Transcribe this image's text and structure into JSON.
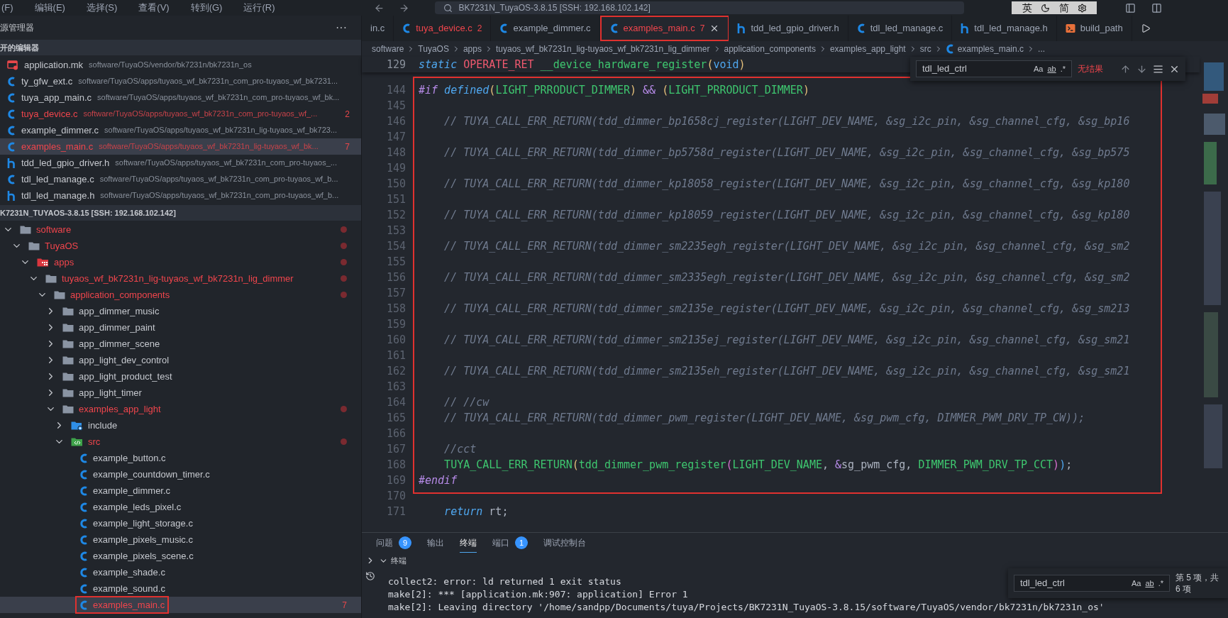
{
  "title_bar": {
    "menus": [
      "(F)",
      "编辑(E)",
      "选择(S)",
      "查看(V)",
      "转到(G)",
      "运行(R)"
    ],
    "command_center": "BK7231N_TuyaOS-3.8.15 [SSH: 192.168.102.142]",
    "ime": [
      "英",
      "简"
    ]
  },
  "explorer": {
    "title": "源管理器",
    "more": "···",
    "open_editors": {
      "title": "开的编辑器",
      "items": [
        {
          "name": "application.mk",
          "path": "software/TuyaOS/vendor/bk7231n/bk7231n_os",
          "kind": "mk-file",
          "error": false,
          "selected": false
        },
        {
          "name": "ty_gfw_ext.c",
          "path": "software/TuyaOS/apps/tuyaos_wf_bk7231n_com_pro-tuyaos_wf_bk7231...",
          "kind": "c-file",
          "error": false,
          "selected": false
        },
        {
          "name": "tuya_app_main.c",
          "path": "software/TuyaOS/apps/tuyaos_wf_bk7231n_com_pro-tuyaos_wf_bk...",
          "kind": "c-file",
          "error": false,
          "selected": false
        },
        {
          "name": "tuya_device.c",
          "path": "software/TuyaOS/apps/tuyaos_wf_bk7231n_com_pro-tuyaos_wf_...",
          "kind": "c-file",
          "badge": "2",
          "error": true,
          "selected": false
        },
        {
          "name": "example_dimmer.c",
          "path": "software/TuyaOS/apps/tuyaos_wf_bk7231n_lig-tuyaos_wf_bk723...",
          "kind": "c-file",
          "error": false,
          "selected": false
        },
        {
          "name": "examples_main.c",
          "path": "software/TuyaOS/apps/tuyaos_wf_bk7231n_lig-tuyaos_wf_bk...",
          "kind": "c-file",
          "badge": "7",
          "error": true,
          "selected": true
        },
        {
          "name": "tdd_led_gpio_driver.h",
          "path": "software/TuyaOS/apps/tuyaos_wf_bk7231n_com_pro-tuyaos_...",
          "kind": "h-file",
          "error": false,
          "selected": false
        },
        {
          "name": "tdl_led_manage.c",
          "path": "software/TuyaOS/apps/tuyaos_wf_bk7231n_com_pro-tuyaos_wf_b...",
          "kind": "c-file",
          "error": false,
          "selected": false
        },
        {
          "name": "tdl_led_manage.h",
          "path": "software/TuyaOS/apps/tuyaos_wf_bk7231n_com_pro-tuyaos_wf_b...",
          "kind": "h-file",
          "error": false,
          "selected": false
        }
      ]
    },
    "workspace": {
      "title": "K7231N_TUYAOS-3.8.15 [SSH: 192.168.102.142]",
      "tree": [
        {
          "label": "software",
          "kind": "folder",
          "expanded": true,
          "error": true,
          "selected": false,
          "framed": false,
          "children": [
            {
              "label": "TuyaOS",
              "kind": "folder",
              "expanded": true,
              "error": true,
              "selected": false,
              "framed": false,
              "children": [
                {
                  "label": "apps",
                  "kind": "app-folder",
                  "expanded": true,
                  "error": true,
                  "selected": false,
                  "framed": false,
                  "children": [
                    {
                      "label": "tuyaos_wf_bk7231n_lig-tuyaos_wf_bk7231n_lig_dimmer",
                      "kind": "folder",
                      "expanded": true,
                      "error": true,
                      "selected": false,
                      "framed": false,
                      "children": [
                        {
                          "label": "application_components",
                          "kind": "folder",
                          "expanded": true,
                          "error": true,
                          "selected": false,
                          "framed": false,
                          "children": [
                            {
                              "label": "app_dimmer_music",
                              "kind": "folder",
                              "expanded": false,
                              "error": false,
                              "selected": false,
                              "framed": false
                            },
                            {
                              "label": "app_dimmer_paint",
                              "kind": "folder",
                              "expanded": false,
                              "error": false,
                              "selected": false,
                              "framed": false
                            },
                            {
                              "label": "app_dimmer_scene",
                              "kind": "folder",
                              "expanded": false,
                              "error": false,
                              "selected": false,
                              "framed": false
                            },
                            {
                              "label": "app_light_dev_control",
                              "kind": "folder",
                              "expanded": false,
                              "error": false,
                              "selected": false,
                              "framed": false
                            },
                            {
                              "label": "app_light_product_test",
                              "kind": "folder",
                              "expanded": false,
                              "error": false,
                              "selected": false,
                              "framed": false
                            },
                            {
                              "label": "app_light_timer",
                              "kind": "folder",
                              "expanded": false,
                              "error": false,
                              "selected": false,
                              "framed": false
                            },
                            {
                              "label": "examples_app_light",
                              "kind": "folder",
                              "expanded": true,
                              "error": true,
                              "selected": false,
                              "framed": false,
                              "children": [
                                {
                                  "label": "include",
                                  "kind": "include-folder",
                                  "expanded": false,
                                  "error": false,
                                  "selected": false,
                                  "framed": false
                                },
                                {
                                  "label": "src",
                                  "kind": "src-folder",
                                  "expanded": true,
                                  "error": true,
                                  "selected": false,
                                  "framed": false,
                                  "children": [
                                    {
                                      "label": "example_button.c",
                                      "kind": "c-file",
                                      "error": false,
                                      "selected": false,
                                      "framed": false
                                    },
                                    {
                                      "label": "example_countdown_timer.c",
                                      "kind": "c-file",
                                      "error": false,
                                      "selected": false,
                                      "framed": false
                                    },
                                    {
                                      "label": "example_dimmer.c",
                                      "kind": "c-file",
                                      "error": false,
                                      "selected": false,
                                      "framed": false
                                    },
                                    {
                                      "label": "example_leds_pixel.c",
                                      "kind": "c-file",
                                      "error": false,
                                      "selected": false,
                                      "framed": false
                                    },
                                    {
                                      "label": "example_light_storage.c",
                                      "kind": "c-file",
                                      "error": false,
                                      "selected": false,
                                      "framed": false
                                    },
                                    {
                                      "label": "example_pixels_music.c",
                                      "kind": "c-file",
                                      "error": false,
                                      "selected": false,
                                      "framed": false
                                    },
                                    {
                                      "label": "example_pixels_scene.c",
                                      "kind": "c-file",
                                      "error": false,
                                      "selected": false,
                                      "framed": false
                                    },
                                    {
                                      "label": "example_shade.c",
                                      "kind": "c-file",
                                      "error": false,
                                      "selected": false,
                                      "framed": false
                                    },
                                    {
                                      "label": "example_sound.c",
                                      "kind": "c-file",
                                      "error": false,
                                      "selected": false,
                                      "framed": false
                                    },
                                    {
                                      "label": "examples_main.c",
                                      "kind": "c-file",
                                      "badge": "7",
                                      "error": true,
                                      "selected": true,
                                      "framed": true
                                    }
                                  ]
                                }
                              ]
                            }
                          ]
                        }
                      ]
                    }
                  ]
                }
              ]
            }
          ]
        }
      ]
    }
  },
  "editor": {
    "tabs": [
      {
        "label": "in.c",
        "kind": "cut",
        "error": false,
        "selected": false,
        "framed": false
      },
      {
        "label": "tuya_device.c",
        "kind": "c-file",
        "badge": "2",
        "error": true,
        "selected": false,
        "framed": false
      },
      {
        "label": "example_dimmer.c",
        "kind": "c-file",
        "error": false,
        "selected": false,
        "framed": false
      },
      {
        "label": "examples_main.c",
        "kind": "c-file",
        "badge": "7",
        "error": true,
        "selected": true,
        "framed": true
      },
      {
        "label": "tdd_led_gpio_driver.h",
        "kind": "h-file",
        "error": false,
        "selected": false,
        "framed": false
      },
      {
        "label": "tdl_led_manage.c",
        "kind": "c-file",
        "error": false,
        "selected": false,
        "framed": false
      },
      {
        "label": "tdl_led_manage.h",
        "kind": "h-file",
        "error": false,
        "selected": false,
        "framed": false
      },
      {
        "label": "build_path",
        "kind": "terminal",
        "error": false,
        "selected": false,
        "framed": false
      }
    ],
    "breadcrumb": [
      {
        "label": "software",
        "kind": "text"
      },
      {
        "label": "TuyaOS",
        "kind": "text"
      },
      {
        "label": "apps",
        "kind": "text"
      },
      {
        "label": "tuyaos_wf_bk7231n_lig-tuyaos_wf_bk7231n_lig_dimmer",
        "kind": "text"
      },
      {
        "label": "application_components",
        "kind": "text"
      },
      {
        "label": "examples_app_light",
        "kind": "text"
      },
      {
        "label": "src",
        "kind": "text"
      },
      {
        "label": "examples_main.c",
        "kind": "c-file"
      },
      {
        "label": "...",
        "kind": "text"
      }
    ],
    "find": {
      "value": "tdl_led_ctrl",
      "options": [
        "Aa",
        "ab",
        ".*"
      ],
      "result": "无结果"
    },
    "sticky_line": {
      "number": "129",
      "tokens": [
        {
          "text": "static",
          "kind": "keyword"
        },
        {
          "text": " OPERATE_RET",
          "kind": "type"
        },
        {
          "text": " __device_hardware_register",
          "kind": "function"
        },
        {
          "text": "(",
          "kind": "paren"
        },
        {
          "text": "void",
          "kind": "param"
        },
        {
          "text": ")",
          "kind": "paren"
        }
      ]
    },
    "framed_lines": [
      {
        "number": "144",
        "tokens": [
          {
            "text": "#if",
            "kind": "directive"
          },
          {
            "text": " defined",
            "kind": "keyword"
          },
          {
            "text": "(",
            "kind": "paren"
          },
          {
            "text": "LIGHT_PRRODUCT_DIMMER",
            "kind": "function"
          },
          {
            "text": ")",
            "kind": "paren"
          },
          {
            "text": " &&",
            "kind": "operator"
          },
          {
            "text": " (",
            "kind": "paren"
          },
          {
            "text": "LIGHT_PRRODUCT_DIMMER",
            "kind": "function"
          },
          {
            "text": ")",
            "kind": "paren"
          }
        ]
      },
      {
        "number": "145"
      },
      {
        "number": "146",
        "tokens": [
          {
            "text": "    // TUYA_CALL_ERR_RETURN(tdd_dimmer_bp1658cj_register(LIGHT_DEV_NAME, &sg_i2c_pin, &sg_channel_cfg, &sg_bp16",
            "kind": "comment"
          }
        ]
      },
      {
        "number": "147"
      },
      {
        "number": "148",
        "tokens": [
          {
            "text": "    // TUYA_CALL_ERR_RETURN(tdd_dimmer_bp5758d_register(LIGHT_DEV_NAME, &sg_i2c_pin, &sg_channel_cfg, &sg_bp575",
            "kind": "comment"
          }
        ]
      },
      {
        "number": "149"
      },
      {
        "number": "150",
        "tokens": [
          {
            "text": "    // TUYA_CALL_ERR_RETURN(tdd_dimmer_kp18058_register(LIGHT_DEV_NAME, &sg_i2c_pin, &sg_channel_cfg, &sg_kp180",
            "kind": "comment"
          }
        ]
      },
      {
        "number": "151"
      },
      {
        "number": "152",
        "tokens": [
          {
            "text": "    // TUYA_CALL_ERR_RETURN(tdd_dimmer_kp18059_register(LIGHT_DEV_NAME, &sg_i2c_pin, &sg_channel_cfg, &sg_kp180",
            "kind": "comment"
          }
        ]
      },
      {
        "number": "153"
      },
      {
        "number": "154",
        "tokens": [
          {
            "text": "    // TUYA_CALL_ERR_RETURN(tdd_dimmer_sm2235egh_register(LIGHT_DEV_NAME, &sg_i2c_pin, &sg_channel_cfg, &sg_sm2",
            "kind": "comment"
          }
        ]
      },
      {
        "number": "155"
      },
      {
        "number": "156",
        "tokens": [
          {
            "text": "    // TUYA_CALL_ERR_RETURN(tdd_dimmer_sm2335egh_register(LIGHT_DEV_NAME, &sg_i2c_pin, &sg_channel_cfg, &sg_sm2",
            "kind": "comment"
          }
        ]
      },
      {
        "number": "157"
      },
      {
        "number": "158",
        "tokens": [
          {
            "text": "    // TUYA_CALL_ERR_RETURN(tdd_dimmer_sm2135e_register(LIGHT_DEV_NAME, &sg_i2c_pin, &sg_channel_cfg, &sg_sm213",
            "kind": "comment"
          }
        ]
      },
      {
        "number": "159"
      },
      {
        "number": "160",
        "tokens": [
          {
            "text": "    // TUYA_CALL_ERR_RETURN(tdd_dimmer_sm2135ej_register(LIGHT_DEV_NAME, &sg_i2c_pin, &sg_channel_cfg, &sg_sm21",
            "kind": "comment"
          }
        ]
      },
      {
        "number": "161"
      },
      {
        "number": "162",
        "tokens": [
          {
            "text": "    // TUYA_CALL_ERR_RETURN(tdd_dimmer_sm2135eh_register(LIGHT_DEV_NAME, &sg_i2c_pin, &sg_channel_cfg, &sg_sm21",
            "kind": "comment"
          }
        ]
      },
      {
        "number": "163"
      },
      {
        "number": "164",
        "tokens": [
          {
            "text": "    // //cw",
            "kind": "comment"
          }
        ]
      },
      {
        "number": "165",
        "tokens": [
          {
            "text": "    // TUYA_CALL_ERR_RETURN(tdd_dimmer_pwm_register(LIGHT_DEV_NAME, &sg_pwm_cfg, DIMMER_PWM_DRV_TP_CW));",
            "kind": "comment"
          }
        ]
      },
      {
        "number": "166"
      },
      {
        "number": "167",
        "tokens": [
          {
            "text": "    //cct",
            "kind": "comment"
          }
        ]
      },
      {
        "number": "168",
        "tokens": [
          {
            "text": "    TUYA_CALL_ERR_RETURN",
            "kind": "function"
          },
          {
            "text": "(",
            "kind": "paren"
          },
          {
            "text": "tdd_dimmer_pwm_register",
            "kind": "function"
          },
          {
            "text": "(",
            "kind": "paren2"
          },
          {
            "text": "LIGHT_DEV_NAME",
            "kind": "function"
          },
          {
            "text": ", ",
            "kind": "plain"
          },
          {
            "text": "&",
            "kind": "operator"
          },
          {
            "text": "sg_pwm_cfg, ",
            "kind": "plain"
          },
          {
            "text": "DIMMER_PWM_DRV_TP_CCT",
            "kind": "function"
          },
          {
            "text": ")",
            "kind": "paren2"
          },
          {
            "text": ")",
            "kind": "paren3"
          },
          {
            "text": ";",
            "kind": "plain"
          }
        ]
      },
      {
        "number": "169",
        "tokens": [
          {
            "text": "#endif",
            "kind": "directive"
          }
        ]
      }
    ],
    "lines": [
      {
        "number": "170"
      },
      {
        "number": "171",
        "tokens": [
          {
            "text": "    return",
            "kind": "keyword"
          },
          {
            "text": " rt;",
            "kind": "plain"
          }
        ]
      }
    ]
  },
  "panel": {
    "tabs": [
      {
        "label": "问题",
        "badge": "9",
        "selected": false
      },
      {
        "label": "输出",
        "selected": false
      },
      {
        "label": "终端",
        "selected": true
      },
      {
        "label": "端口",
        "badge": "1",
        "selected": false
      },
      {
        "label": "调试控制台",
        "selected": false
      }
    ],
    "terminal": {
      "title": "终端",
      "lines": [
        "collect2: error: ld returned 1 exit status",
        "make[2]: *** [application.mk:907: application] Error 1",
        "make[2]: Leaving directory '/home/sandpp/Documents/tuya/Projects/BK7231N_TuyaOS-3.8.15/software/TuyaOS/vendor/bk7231n/bk7231n_os'"
      ],
      "find": {
        "value": "tdl_led_ctrl",
        "options": [
          "Aa",
          "ab",
          ".*"
        ],
        "result": "第 5 项，共 6 项"
      }
    }
  }
}
